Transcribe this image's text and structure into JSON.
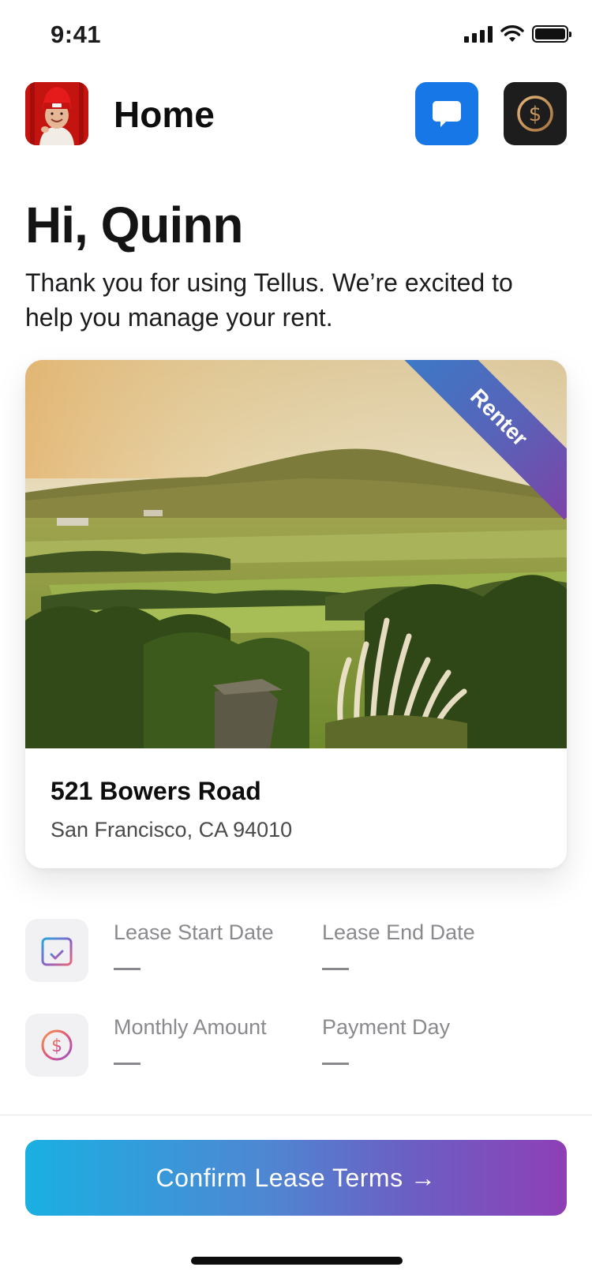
{
  "status_bar": {
    "time": "9:41"
  },
  "header": {
    "title": "Home"
  },
  "greeting": {
    "title": "Hi, Quinn",
    "message": "Thank you for using Tellus. We’re excited to help you manage your rent."
  },
  "property": {
    "badge": "Renter",
    "address": "521 Bowers Road",
    "city": "San Francisco, CA 94010"
  },
  "lease": {
    "start_label": "Lease Start Date",
    "start_value": "—",
    "end_label": "Lease End Date",
    "end_value": "—",
    "amount_label": "Monthly Amount",
    "amount_value": "—",
    "payday_label": "Payment Day",
    "payday_value": "—"
  },
  "cta": {
    "label": "Confirm Lease Terms →"
  },
  "colors": {
    "chat_button": "#1877e6",
    "wallet_button": "#1d1d1d",
    "cta_start": "#1ab0e2",
    "cta_end": "#8e3fb6"
  },
  "icons": [
    "signal-icon",
    "wifi-icon",
    "battery-icon",
    "chat-bubble-icon",
    "dollar-coin-icon",
    "calendar-check-icon",
    "dollar-circle-icon"
  ]
}
